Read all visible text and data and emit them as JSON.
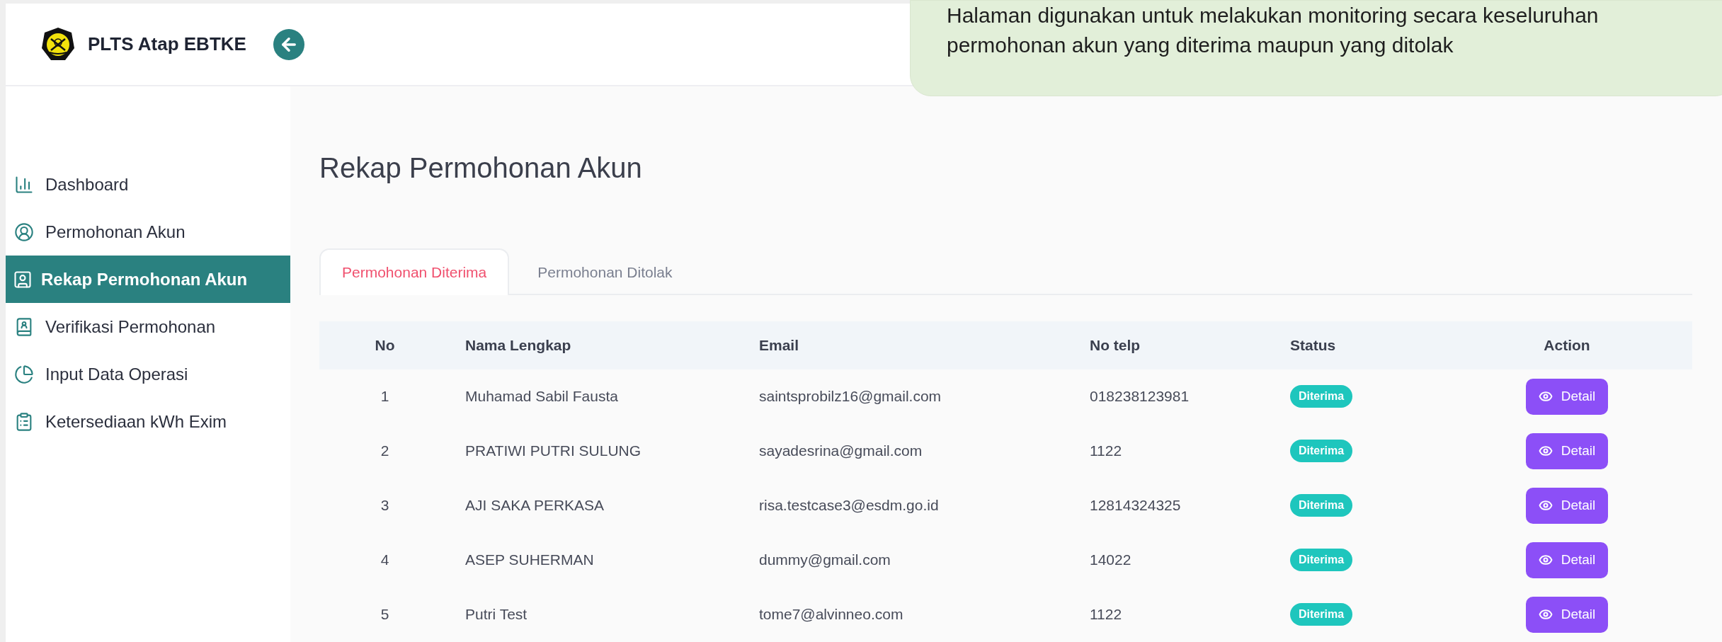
{
  "app": {
    "title": "PLTS Atap EBTKE"
  },
  "callout": {
    "text": "Halaman digunakan untuk melakukan monitoring secara keseluruhan permohonan akun yang diterima maupun yang ditolak"
  },
  "sidebar": {
    "items": [
      {
        "label": "Dashboard",
        "selected": false
      },
      {
        "label": "Permohonan Akun",
        "selected": false
      },
      {
        "label": "Rekap Permohonan Akun",
        "selected": true
      },
      {
        "label": "Verifikasi Permohonan",
        "selected": false
      },
      {
        "label": "Input Data Operasi",
        "selected": false
      },
      {
        "label": "Ketersediaan kWh Exim",
        "selected": false
      }
    ]
  },
  "page": {
    "title": "Rekap Permohonan Akun"
  },
  "tabs": [
    {
      "label": "Permohonan Diterima",
      "selected": true
    },
    {
      "label": "Permohonan Ditolak",
      "selected": false
    }
  ],
  "table": {
    "columns": [
      "No",
      "Nama Lengkap",
      "Email",
      "No telp",
      "Status",
      "Action"
    ],
    "rows": [
      {
        "no": "1",
        "name": "Muhamad Sabil Fausta",
        "email": "saintsprobilz16@gmail.com",
        "phone": "018238123981",
        "status": "Diterima",
        "action": "Detail"
      },
      {
        "no": "2",
        "name": "PRATIWI PUTRI SULUNG",
        "email": "sayadesrina@gmail.com",
        "phone": "1122",
        "status": "Diterima",
        "action": "Detail"
      },
      {
        "no": "3",
        "name": "AJI SAKA PERKASA",
        "email": "risa.testcase3@esdm.go.id",
        "phone": "12814324325",
        "status": "Diterima",
        "action": "Detail"
      },
      {
        "no": "4",
        "name": "ASEP SUHERMAN",
        "email": "dummy@gmail.com",
        "phone": "14022",
        "status": "Diterima",
        "action": "Detail"
      },
      {
        "no": "5",
        "name": "Putri Test",
        "email": "tome7@alvinneo.com",
        "phone": "1122",
        "status": "Diterima",
        "action": "Detail"
      }
    ]
  }
}
